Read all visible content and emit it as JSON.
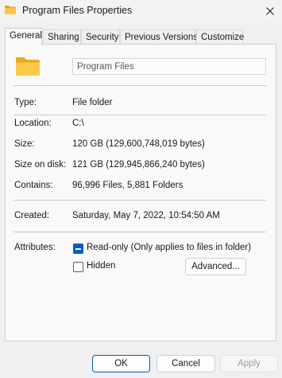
{
  "window": {
    "title": "Program Files Properties",
    "icon": "folder-icon",
    "close_icon": "close-icon"
  },
  "tabs": [
    {
      "label": "General",
      "active": true
    },
    {
      "label": "Sharing",
      "active": false
    },
    {
      "label": "Security",
      "active": false
    },
    {
      "label": "Previous Versions",
      "active": false
    },
    {
      "label": "Customize",
      "active": false
    }
  ],
  "general": {
    "name": "Program Files",
    "type_label": "Type:",
    "type_value": "File folder",
    "location_label": "Location:",
    "location_value": "C:\\",
    "size_label": "Size:",
    "size_value": "120 GB (129,600,748,019 bytes)",
    "size_on_disk_label": "Size on disk:",
    "size_on_disk_value": "121 GB (129,945,866,240 bytes)",
    "contains_label": "Contains:",
    "contains_value": "96,996 Files, 5,881 Folders",
    "created_label": "Created:",
    "created_value": "Saturday, May 7, 2022, 10:54:50 AM",
    "attributes_label": "Attributes:",
    "readonly_label": "Read-only (Only applies to files in folder)",
    "readonly_state": "indeterminate",
    "hidden_label": "Hidden",
    "hidden_checked": false,
    "advanced_label": "Advanced..."
  },
  "buttons": {
    "ok": "OK",
    "cancel": "Cancel",
    "apply": "Apply"
  },
  "colors": {
    "accent": "#0a5bc4",
    "folder_yellow": "#f8c640"
  }
}
